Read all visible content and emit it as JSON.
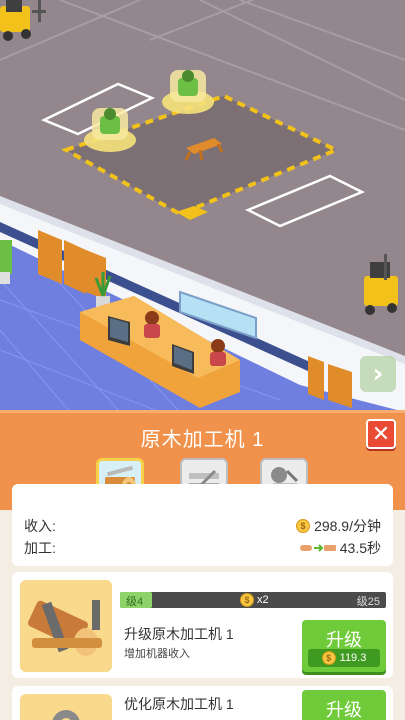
{
  "scene": {
    "icons": {
      "forklift": "forklift-icon",
      "worker": "worker-icon",
      "computer": "computer-icon",
      "plant": "plant-icon",
      "arrow": "arrow-right-icon"
    },
    "colors": {
      "floor": "#93868c",
      "pad": "#7d7075",
      "hazard": "#f2c21a",
      "desk": "#f0a23b",
      "wall": "#f5f6fa",
      "tile": "#6f7fe0"
    }
  },
  "panel": {
    "title": "原木加工机 1",
    "close_icon": "close-icon",
    "tabs": [
      {
        "icon": "log-icon",
        "active": true
      },
      {
        "icon": "saw-blade-icon",
        "active": false
      },
      {
        "icon": "grinder-icon",
        "active": false
      }
    ],
    "stats": {
      "income_label": "收入:",
      "income_value": "298.9/分钟",
      "process_label": "加工:",
      "process_value": "43.5秒"
    },
    "upgrades": [
      {
        "level_current": "级4",
        "multiplier": "x2",
        "level_target": "级25",
        "progress": 0.12,
        "title": "升级原木加工机 1",
        "desc": "增加机器收入",
        "button": "升级",
        "cost": "119.3",
        "icon": "log-saw-icon"
      },
      {
        "title": "优化原木加工机 1",
        "button": "升级",
        "icon": "gear-icon"
      }
    ],
    "colors": {
      "header": "#f0924b",
      "button": "#6fcb3a",
      "close": "#e94b35"
    }
  }
}
